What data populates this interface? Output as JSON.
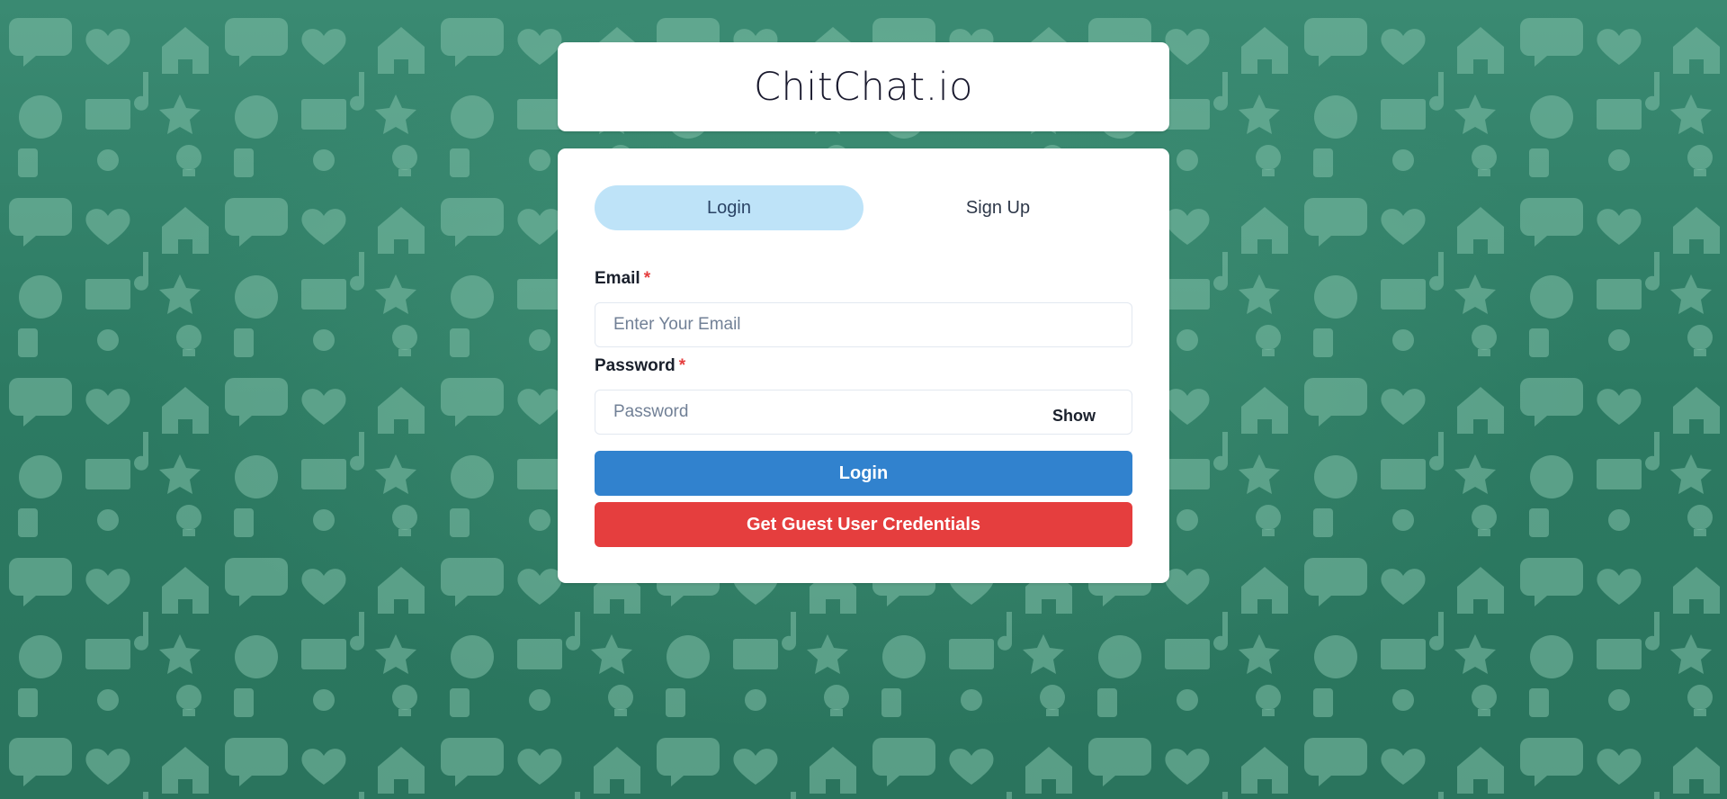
{
  "app": {
    "title": "ChitChat.io"
  },
  "tabs": [
    {
      "label": "Login",
      "active": true
    },
    {
      "label": "Sign Up",
      "active": false
    }
  ],
  "form": {
    "email": {
      "label": "Email",
      "required_mark": "*",
      "placeholder": "Enter Your Email",
      "value": ""
    },
    "password": {
      "label": "Password",
      "required_mark": "*",
      "placeholder": "Password",
      "value": "",
      "toggle_label": "Show"
    },
    "login_button": "Login",
    "guest_button": "Get Guest User Credentials"
  },
  "colors": {
    "background": "#2e7d66",
    "active_tab": "#bee3f8",
    "primary": "#3182ce",
    "danger": "#e53e3e",
    "required": "#e53e3e"
  },
  "background_pattern": {
    "icons": [
      "chat-bubble-icon",
      "envelope-icon",
      "globe-icon",
      "lightbulb-icon",
      "music-note-icon",
      "camera-icon",
      "house-icon",
      "user-icon",
      "gear-icon",
      "magnifier-icon",
      "heart-icon",
      "star-icon",
      "cloud-icon",
      "phone-icon",
      "at-sign-icon",
      "info-icon"
    ]
  }
}
